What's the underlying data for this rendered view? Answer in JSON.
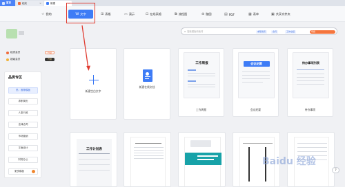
{
  "tabs": [
    {
      "label": "首页",
      "active": true
    },
    {
      "label": "稻壳",
      "active": false
    },
    {
      "label": "新建",
      "active": false
    }
  ],
  "toolbar": {
    "items": [
      {
        "label": "我的",
        "icon": "star-icon"
      },
      {
        "label": "文字",
        "icon": "writer-icon",
        "active": true
      },
      {
        "label": "表格",
        "icon": "sheet-icon"
      },
      {
        "label": "演示",
        "icon": "slides-icon"
      },
      {
        "label": "在线表格",
        "icon": "sheet-online-icon"
      },
      {
        "label": "流程图",
        "icon": "flowchart-icon"
      },
      {
        "label": "脑图",
        "icon": "mindmap-icon"
      },
      {
        "label": "PDF",
        "icon": "pdf-icon"
      },
      {
        "label": "表单",
        "icon": "form-icon"
      },
      {
        "label": "共享文件夹",
        "icon": "folder-icon"
      }
    ]
  },
  "sidebar": {
    "vip": [
      {
        "label": "稻壳会员",
        "button": "升级",
        "color": "#f06a3a"
      },
      {
        "label": "超级会员",
        "button": "开通",
        "color": "#333333"
      }
    ],
    "category_title": "品类专区",
    "categories": [
      "热：推荐模板",
      "求职简历",
      "人事行政",
      "法律合同",
      "市场营销",
      "平面设计",
      "财务办公",
      "更多模板"
    ]
  },
  "search": {
    "placeholder": "搜索模板和素材",
    "chips": [
      "求职简历",
      "合同",
      "工作总结",
      "年终"
    ]
  },
  "cards": [
    {
      "label": "新建空白文字"
    },
    {
      "label": "新建在线文档"
    },
    {
      "label": "工作周报",
      "title": "工作周报"
    },
    {
      "label": "会议纪要",
      "title": "会议纪要"
    },
    {
      "label": "待办事项",
      "title": "待办事项列表"
    }
  ],
  "bottom_cards": [
    {
      "title": "工作计划表"
    },
    {
      "title": ""
    },
    {
      "title": ""
    },
    {
      "title": ""
    },
    {
      "title": ""
    }
  ],
  "colors": {
    "accent": "#3e7cf6",
    "highlight": "#e03a2f"
  },
  "watermark": "Baidu 经验"
}
